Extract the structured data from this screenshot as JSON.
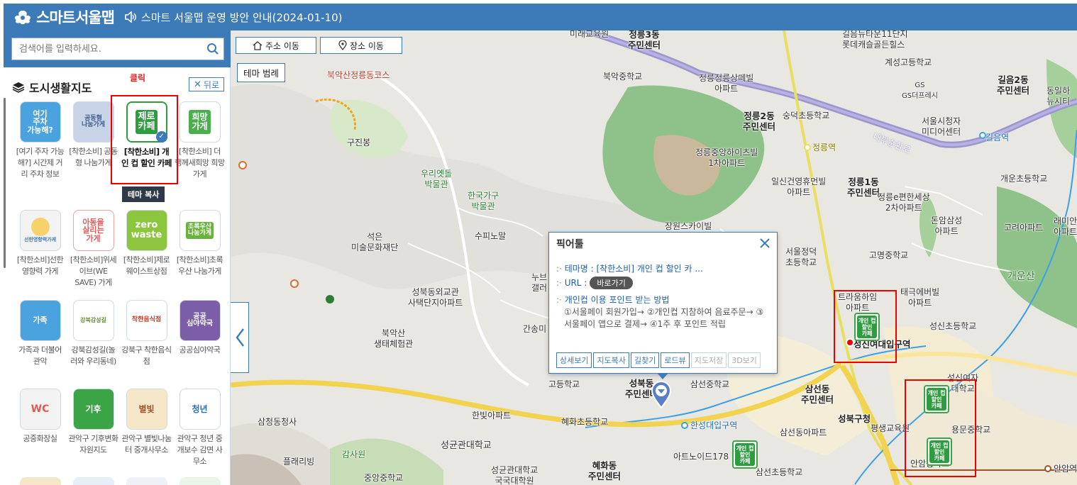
{
  "header": {
    "logo_text": "스마트서울맵",
    "notice": "스마트 서울맵 운영 방안 안내(2024-01-10)"
  },
  "search": {
    "placeholder": "검색어를 입력하세요."
  },
  "sidebar": {
    "annotation": "클릭",
    "category": "도시생활지도",
    "back_label": "뒤로",
    "tooltip": "테마 복사",
    "tiles": [
      {
        "label": "[여기 주자 가능해?] 시간제 거리 주차 정보",
        "icon_text": "여기\n주차\n가능해?",
        "bg": "#4aa3df"
      },
      {
        "label": "[착한소비] 공동형 나눔가게",
        "icon_text": "공동형\n나눔가게",
        "bg": "#c7d3e6"
      },
      {
        "label": "[착한소비] 개인 컵 할인 카페",
        "icon_text": "제로\n카페",
        "bg": "#2e9d3f"
      },
      {
        "label": "[착한소비] 더 행께새희망 희망가게",
        "icon_text": "희망\n가게",
        "bg": "#4cae4f"
      },
      {
        "label": "[착한소비]선한영향력 가게",
        "icon_text": "선한영향력가게",
        "bg": "#f3f3f3"
      },
      {
        "label": "[착한소비]위세이브(WE SAVE) 가게",
        "icon_text": "아동을\n살리는\n가게",
        "bg": "#ffffff"
      },
      {
        "label": "[착한소비]제로웨이스트상점",
        "icon_text": "zero\nwaste",
        "bg": "#8cc63f"
      },
      {
        "label": "[착한소비]초록우산 나눔가게",
        "icon_text": "초록우산\n나눔가게",
        "bg": "#ffffff"
      },
      {
        "label": "가족과 더불어 관악",
        "icon_text": "가족",
        "bg": "#4aa3df"
      },
      {
        "label": "강북감성길(놀러와 우리동네)",
        "icon_text": "강북감성길",
        "bg": "#ffffff"
      },
      {
        "label": "강북구 착한음식점",
        "icon_text": "착한음식점",
        "bg": "#ffffff"
      },
      {
        "label": "공공심야약국",
        "icon_text": "공공\n심야약국",
        "bg": "#7b5ea7"
      },
      {
        "label": "공중화장실",
        "icon_text": "WC",
        "bg": "#f3f3f3"
      },
      {
        "label": "관악구 기후변화자원지도",
        "icon_text": "기후",
        "bg": "#3aa447"
      },
      {
        "label": "관악구 별빛나눔터 중개사무소",
        "icon_text": "별빛",
        "bg": "#f6e7c9"
      },
      {
        "label": "관악구 청년 중개보수 감면 사무소",
        "icon_text": "청년",
        "bg": "#ffffff"
      }
    ]
  },
  "map": {
    "buttons": {
      "address": "주소 이동",
      "place": "장소 이동",
      "legend": "테마 범례"
    },
    "labels": [
      "정릉3동\n주민센터",
      "미래교육원",
      "길음뉴타운11단지\n롯데캐슬골든힐스",
      "계성고등학교",
      "GS\nGS더프레시",
      "길음2동\n주민센터",
      "동일하\n뉴시티",
      "북악산정릉동코스",
      "북악중학교",
      "정릉정릉상떼빌\n아파트",
      "정릉2동\n주민센터",
      "숭덕초등학교",
      "서울시청자\n미디어센터",
      "길음역",
      "내부순환로",
      "구진봉",
      "정릉역",
      "정릉중앙하이츠빌\n1차아파트",
      "개운초등학교",
      "우리옛돌\n박물관",
      "한국가구\n박물관",
      "일신건영휴먼빌\n아파트",
      "정릉1동\n주민센터",
      "정릉e편한세상\n2차아파트",
      "돈암삼성\n아파트",
      "고려아파트",
      "래미안\n아파트",
      "장원스카이빌",
      "석은\n미술문화재단",
      "수피노말",
      "서울정덕\n초등학교",
      "고명중학교",
      "개운산",
      "성북동외교관\n사택단지아파트",
      "누브\n갤러",
      "트라움하임\n아파트",
      "태극에버빌\n아파트",
      "성신초등학교",
      "간송미",
      "북악산\n생태체험관",
      "성신여대입구역",
      "삼선동\n주민센터",
      "성북구청",
      "고등학교",
      "성북동\n주민센터",
      "삼선중학교",
      "한빛아파트",
      "삼청동청사",
      "혜화초등학교",
      "한성대입구역",
      "평생교육원",
      "삼선동아파트",
      "용문중학교",
      "성균관대학교",
      "감사원",
      "아트노이드178",
      "플래리빙",
      "혜화동\n주민센터",
      "성균관대학교\n국국대학원",
      "중앙중학교",
      "삼선초등학교",
      "안암중학교",
      "안암역",
      "성신여자\n대학교"
    ],
    "popup": {
      "title": "픽어툴",
      "theme_key": "테마명 :",
      "theme_value": "[착한소비] 개인 컵 할인 카 ...",
      "url_key": "URL :",
      "url_button": "바로가기",
      "section_title": "개인컵 이용 포인트 받는 방법",
      "desc": "①서울페이 회원가입→ ②개인컵 지참하여 음료주문→ ③서울페이 앱으로 결제→ ④1주 후 포인트 적립",
      "buttons": [
        "상세보기",
        "지도복사",
        "길찾기",
        "로드뷰",
        "지도저장",
        "3D보기"
      ]
    },
    "marker_text": "개인 컵\n할인\n카페"
  }
}
